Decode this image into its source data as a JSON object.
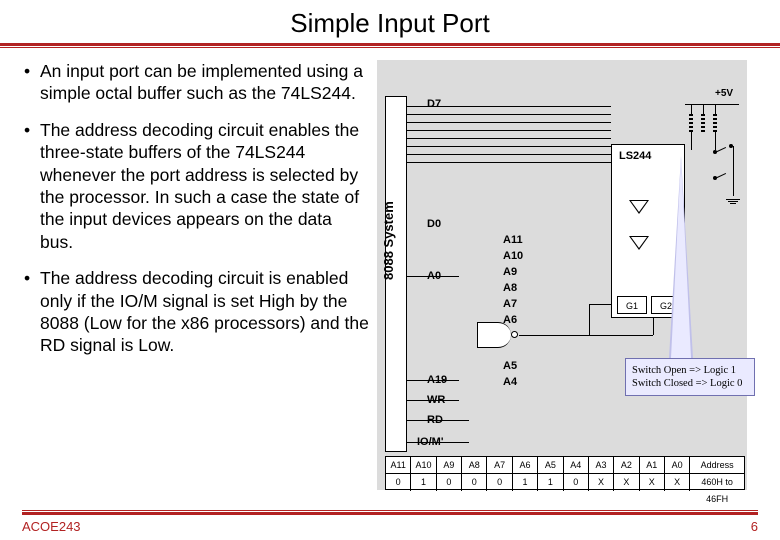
{
  "title": "Simple Input Port",
  "bullets": [
    "An input port can be implemented using a simple octal buffer such as the 74LS244.",
    "The address decoding circuit enables the three-state buffers of the 74LS244 whenever the port address is selected by the processor. In such a case the state of the input devices appears on the data bus.",
    "The address decoding circuit is enabled only if the IO/M signal is set High by the 8088  (Low for the x86 processors) and the RD signal is Low."
  ],
  "diagram": {
    "system_label": "8088 System",
    "signals": {
      "d7": "D7",
      "d0": "D0",
      "a0": "A0",
      "a19": "A19",
      "wr": "WR",
      "rd": "RD",
      "iom": "IO/M'",
      "a11": "A11",
      "a10": "A10",
      "a9": "A9",
      "a8": "A8",
      "a7": "A7",
      "a6": "A6",
      "a5": "A5",
      "a4": "A4"
    },
    "chip": "LS244",
    "g1": "G1",
    "g2": "G2",
    "vcc": "+5V",
    "callout_line1": "Switch Open => Logic 1",
    "callout_line2": "Switch Closed => Logic 0",
    "addr_headers": [
      "A11",
      "A10",
      "A9",
      "A8",
      "A7",
      "A6",
      "A5",
      "A4",
      "A3",
      "A2",
      "A1",
      "A0",
      "Address"
    ],
    "addr_values": [
      "0",
      "1",
      "0",
      "0",
      "0",
      "1",
      "1",
      "0",
      "X",
      "X",
      "X",
      "X",
      "460H to 46FH"
    ]
  },
  "footer": {
    "left": "ACOE243",
    "right": "6"
  }
}
